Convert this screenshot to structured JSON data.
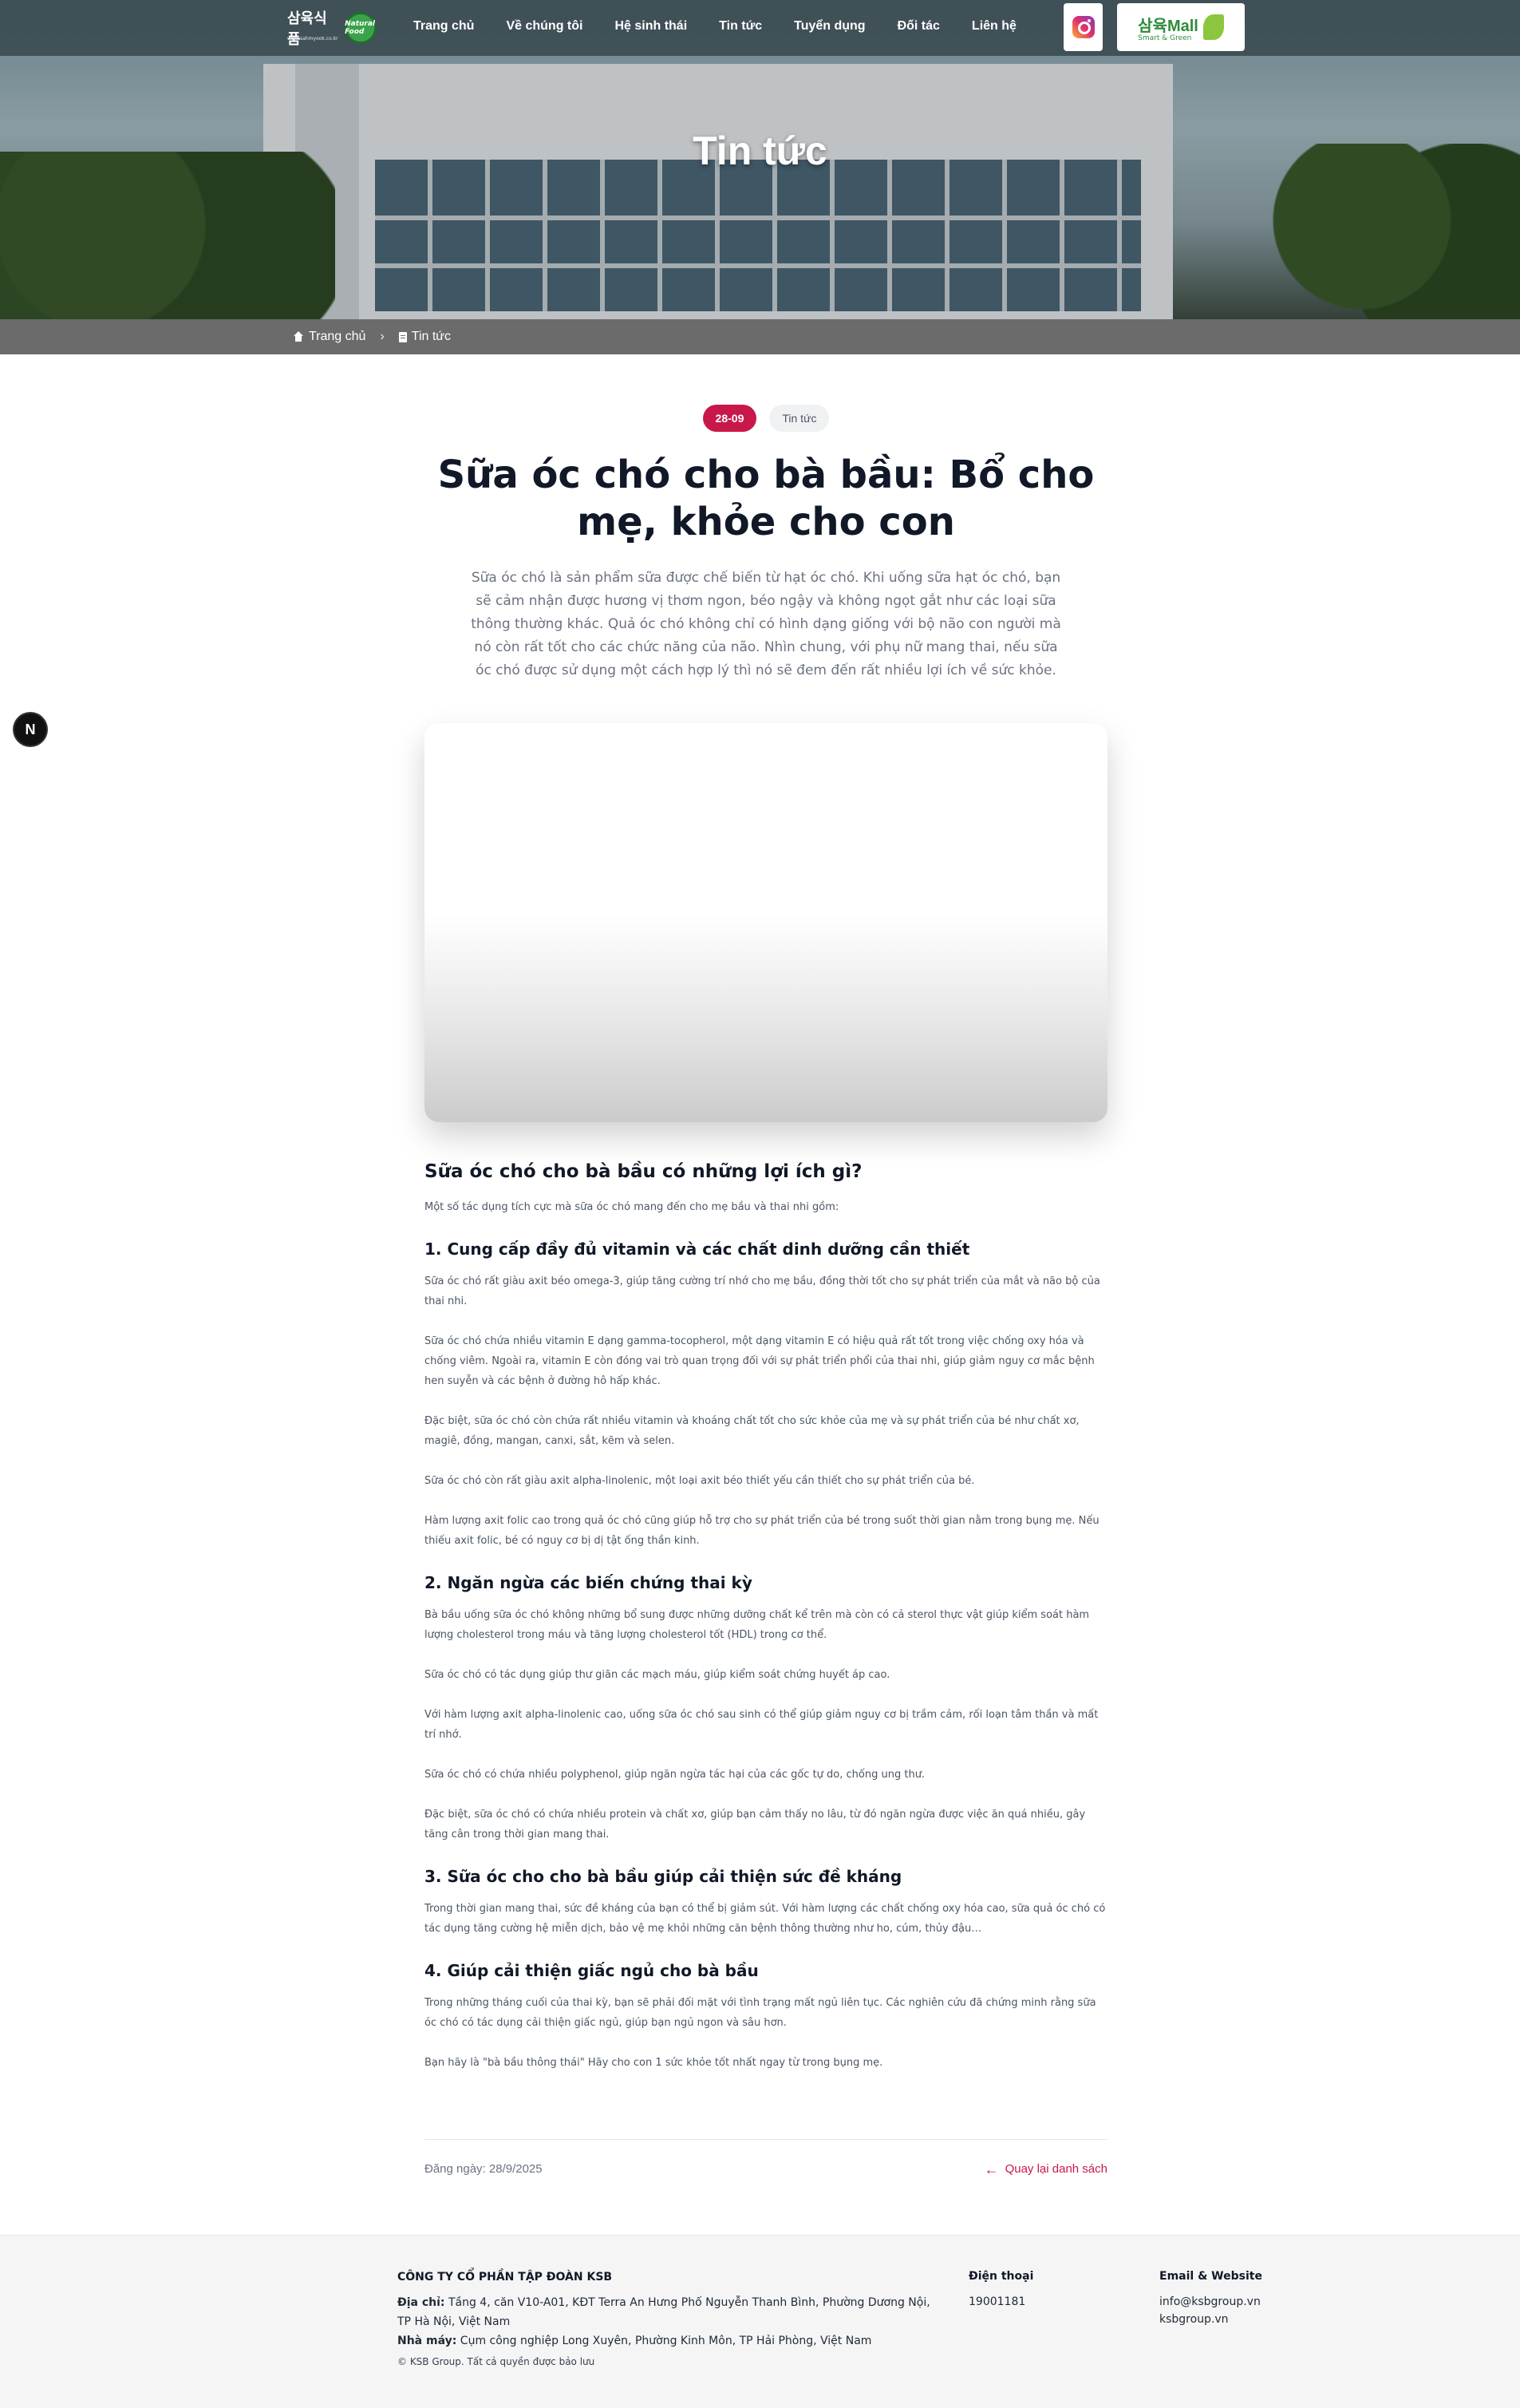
{
  "header": {
    "logo_text": "삼육식품",
    "logo_badge": "Natural Food",
    "logo_sub": "www.sahmyook.co.kr",
    "nav": [
      "Trang chủ",
      "Về chúng tôi",
      "Hệ sinh thái",
      "Tin tức",
      "Tuyển dụng",
      "Đối tác",
      "Liên hệ"
    ],
    "mall_label": "삼육Mall",
    "mall_tagline": "Smart & Green"
  },
  "hero": {
    "title": "Tin tức"
  },
  "breadcrumb": {
    "home": "Trang chủ",
    "current": "Tin tức"
  },
  "article": {
    "date": "28-09",
    "category": "Tin tức",
    "title": "Sữa óc chó cho bà bầu: Bổ cho mẹ, khỏe cho con",
    "lead": "Sữa óc chó là sản phẩm sữa được chế biến từ hạt óc chó. Khi uống sữa hạt óc chó, bạn sẽ cảm nhận được hương vị thơm ngon, béo ngậy và không ngọt gắt như các loại sữa thông thường khác. Quả óc chó không chỉ có hình dạng giống với bộ não con người mà nó còn rất tốt cho các chức năng của não. Nhìn chung, với phụ nữ mang thai, nếu sữa óc chó được sử dụng một cách hợp lý thì nó sẽ đem đến rất nhiều lợi ích về sức khỏe.",
    "h2": "Sữa óc chó cho bà bầu có những lợi ích gì?",
    "intro": "Một số tác dụng tích cực mà sữa óc chó mang đến cho mẹ bầu và thai nhi gồm:",
    "s1_title": "1. Cung cấp đầy đủ vitamin và các chất dinh dưỡng cần thiết",
    "s1_p1": "Sữa óc chó rất giàu axit béo omega-3, giúp tăng cường trí nhớ cho mẹ bầu, đồng thời tốt cho sự phát triển của mắt và não bộ của thai nhi.",
    "s1_p2": "Sữa óc chó chứa nhiều vitamin E dạng gamma-tocopherol, một dạng vitamin E có hiệu quả rất tốt trong việc chống oxy hóa và chống viêm. Ngoài ra, vitamin E còn đóng vai trò quan trọng đối với sự phát triển phổi của thai nhi, giúp giảm nguy cơ mắc bệnh hen suyễn và các bệnh ở đường hô hấp khác.",
    "s1_p3": "Đặc biệt, sữa óc chó còn chứa rất nhiều vitamin và khoáng chất tốt cho sức khỏe của mẹ và sự phát triển của bé như chất xơ, magiê, đồng, mangan, canxi, sắt, kẽm và selen.",
    "s1_p4": "Sữa óc chó còn rất giàu axit alpha-linolenic, một loại axit béo thiết yếu cần thiết cho sự phát triển của bé.",
    "s1_p5": "Hàm lượng axit folic cao trong quả óc chó cũng giúp hỗ trợ cho sự phát triển của bé trong suốt thời gian nằm trong bụng mẹ. Nếu thiếu axit folic, bé có nguy cơ bị dị tật ống thần kinh.",
    "s2_title": "2. Ngăn ngừa các biến chứng thai kỳ",
    "s2_p1": "Bà bầu uống sữa óc chó không những bổ sung được những dưỡng chất kể trên mà còn có cả sterol thực vật giúp kiểm soát hàm lượng cholesterol trong máu và tăng lượng cholesterol tốt (HDL) trong cơ thể.",
    "s2_p2": "Sữa óc chó có tác dụng giúp thư giãn các mạch máu, giúp kiểm soát chứng huyết áp cao.",
    "s2_p3": "Với hàm lượng axit alpha-linolenic cao, uống sữa óc chó sau sinh có thể giúp giảm nguy cơ bị trầm cảm, rối loạn tâm thần và mất trí nhớ.",
    "s2_p4": "Sữa óc chó có chứa nhiều polyphenol, giúp ngăn ngừa tác hại của các gốc tự do, chống ung thư.",
    "s2_p5": "Đặc biệt, sữa óc chó có chứa nhiều protein và chất xơ, giúp bạn cảm thấy no lâu, từ đó ngăn ngừa được việc ăn quá nhiều, gây tăng cân trong thời gian mang thai.",
    "s3_title": "3. Sữa óc cho cho bà bầu giúp cải thiện sức đề kháng",
    "s3_p1": "Trong thời gian mang thai, sức đề kháng của bạn có thể bị giảm sút. Với hàm lượng các chất chống oxy hóa cao, sữa quả óc chó có tác dụng tăng cường hệ miễn dịch, bảo vệ mẹ khỏi những căn bệnh thông thường như ho, cúm, thủy đậu…",
    "s4_title": "4. Giúp cải thiện giấc ngủ cho bà bầu",
    "s4_p1": "Trong những tháng cuối của thai kỳ, bạn sẽ phải đối mặt với tình trạng mất ngủ liên tục. Các nghiên cứu đã chứng minh rằng sữa óc chó có tác dụng cải thiện giấc ngủ, giúp bạn ngủ ngon và sâu hơn.",
    "s4_p2": "Bạn hãy là \"bà bầu thông thái\" Hãy cho con 1 sức khỏe tốt nhất ngay từ trong bụng mẹ.",
    "posted": "Đăng ngày: 28/9/2025",
    "back": "Quay lại danh sách"
  },
  "floating": {
    "badge": "N"
  },
  "footer": {
    "company": "CÔNG TY CỔ PHẦN TẬP ĐOÀN KSB",
    "address_label": "Địa chỉ:",
    "address": "Tầng 4, căn V10-A01, KĐT Terra An Hưng Phố Nguyễn Thanh Bình, Phường Dương Nội, TP Hà Nội, Việt Nam",
    "factory_label": "Nhà máy:",
    "factory": "Cụm công nghiệp Long Xuyên, Phường Kinh Môn, TP Hải Phòng, Việt Nam",
    "copyright": "© KSB Group. Tất cả quyền được bảo lưu",
    "phone_title": "Điện thoại",
    "phone": "19001181",
    "email_title": "Email & Website",
    "email": "info@ksbgroup.vn",
    "website": "ksbgroup.vn"
  },
  "colors": {
    "accent": "#c8184a",
    "topbar": "#3c4c52",
    "breadcrumb_bg": "#6b6b6b"
  },
  "icons": [
    "instagram-icon",
    "home-icon",
    "document-icon",
    "arrow-left-icon"
  ]
}
